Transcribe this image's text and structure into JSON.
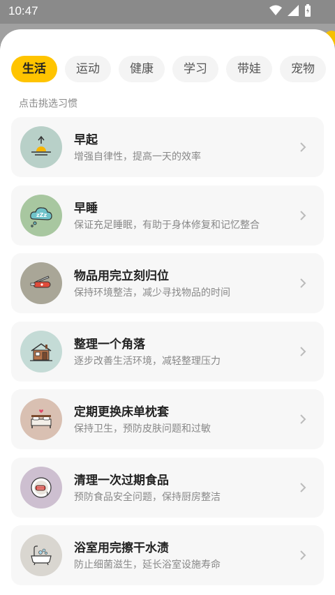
{
  "status_bar": {
    "time": "10:47"
  },
  "tabs": [
    {
      "label": "生活",
      "active": true
    },
    {
      "label": "运动",
      "active": false
    },
    {
      "label": "健康",
      "active": false
    },
    {
      "label": "学习",
      "active": false
    },
    {
      "label": "带娃",
      "active": false
    },
    {
      "label": "宠物",
      "active": false
    }
  ],
  "hint": "点击挑选习惯",
  "colors": {
    "accent": "#ffc400",
    "icon_bg": [
      "#b8d0c8",
      "#a8c7a0",
      "#a9a697",
      "#c4dbd6",
      "#d9c0b2",
      "#cdbfd0",
      "#d9d6d0"
    ]
  },
  "habits": [
    {
      "title": "早起",
      "desc": "增强自律性，提高一天的效率",
      "icon": "sunrise-icon"
    },
    {
      "title": "早睡",
      "desc": "保证充足睡眠，有助于身体修复和记忆整合",
      "icon": "sleep-cloud-icon"
    },
    {
      "title": "物品用完立刻归位",
      "desc": "保持环境整洁，减少寻找物品的时间",
      "icon": "pocket-knife-icon"
    },
    {
      "title": "整理一个角落",
      "desc": "逐步改善生活环境，减轻整理压力",
      "icon": "house-icon"
    },
    {
      "title": "定期更换床单枕套",
      "desc": "保持卫生，预防皮肤问题和过敏",
      "icon": "bed-icon"
    },
    {
      "title": "清理一次过期食品",
      "desc": "预防食品安全问题，保持厨房整洁",
      "icon": "food-plate-icon"
    },
    {
      "title": "浴室用完擦干水渍",
      "desc": "防止细菌滋生，延长浴室设施寿命",
      "icon": "bathtub-icon"
    }
  ]
}
